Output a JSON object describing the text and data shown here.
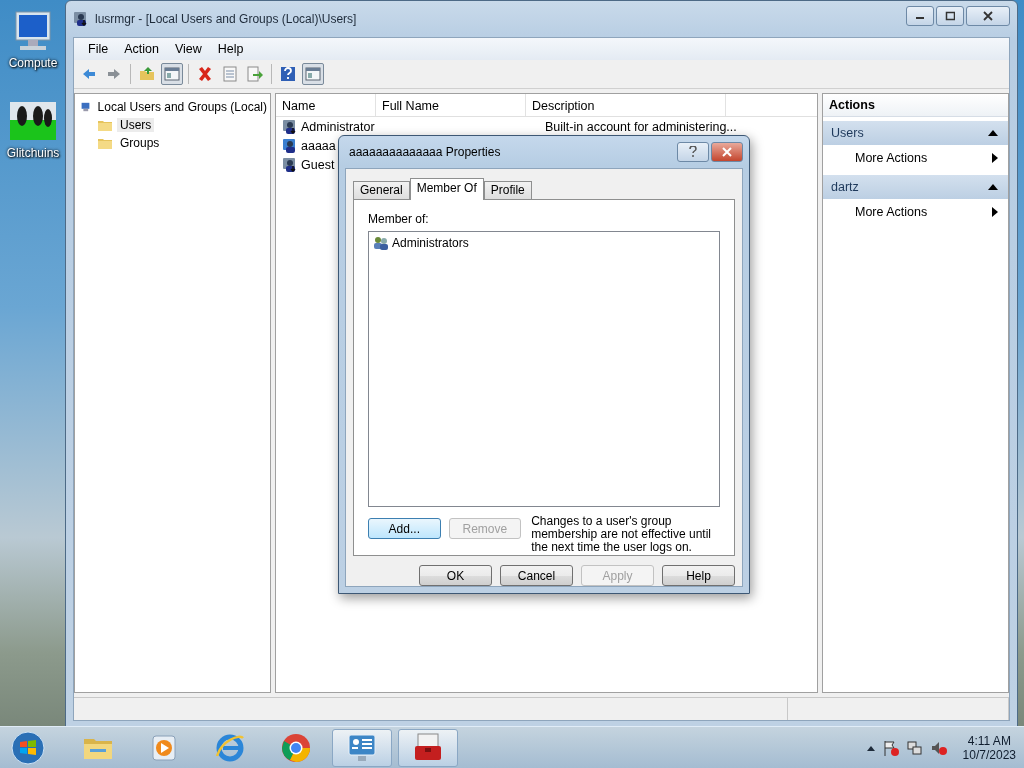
{
  "desktop_icons": [
    {
      "kind": "computer",
      "label": "Compute"
    },
    {
      "kind": "penguins",
      "label": "Glitchuins"
    }
  ],
  "window": {
    "title": "lusrmgr - [Local Users and Groups (Local)\\Users]"
  },
  "menu": [
    "File",
    "Action",
    "View",
    "Help"
  ],
  "toolbar": [
    {
      "kind": "back"
    },
    {
      "kind": "forward"
    },
    {
      "kind": "sep"
    },
    {
      "kind": "up"
    },
    {
      "kind": "pane",
      "selected": true
    },
    {
      "kind": "sep"
    },
    {
      "kind": "delete"
    },
    {
      "kind": "props"
    },
    {
      "kind": "export"
    },
    {
      "kind": "sep"
    },
    {
      "kind": "help"
    },
    {
      "kind": "pane",
      "selected": true
    }
  ],
  "tree": {
    "label": "Local Users and Groups (Local)",
    "children": [
      {
        "label": "Users",
        "selected": true
      },
      {
        "label": "Groups",
        "selected": false
      }
    ]
  },
  "list": {
    "columns": [
      "Name",
      "Full Name",
      "Description"
    ],
    "rows": [
      {
        "name": "Administrator",
        "full_name": "",
        "description": "Built-in account for administering...",
        "kind": "builtin"
      },
      {
        "name": "aaaaa",
        "description": "",
        "kind": "user"
      },
      {
        "name": "Guest",
        "description": "",
        "kind": "builtin"
      }
    ]
  },
  "actions": {
    "title": "Actions",
    "sections": [
      {
        "title": "Users",
        "expanded": true,
        "items": [
          "More Actions"
        ]
      },
      {
        "title": "dartz",
        "expanded": true,
        "items": [
          "More Actions"
        ]
      }
    ]
  },
  "dialog": {
    "title": "aaaaaaaaaaaaaa Properties",
    "tabs": [
      {
        "label": "General",
        "selected": false
      },
      {
        "label": "Member Of",
        "selected": true
      },
      {
        "label": "Profile",
        "selected": false
      }
    ],
    "member_label": "Member of:",
    "members": [
      "Administrators"
    ],
    "buttons": [
      {
        "label": "Add...",
        "disabled": false,
        "focused": true
      },
      {
        "label": "Remove",
        "disabled": true,
        "focused": false
      }
    ],
    "note": "Changes to a user's group membership are not effective until the next time the user logs on.",
    "footer_buttons": [
      {
        "label": "OK",
        "disabled": false
      },
      {
        "label": "Cancel",
        "disabled": false
      },
      {
        "label": "Apply",
        "disabled": true
      },
      {
        "label": "Help",
        "disabled": false
      }
    ]
  },
  "taskbar": {
    "items": [
      {
        "kind": "folder",
        "active": false
      },
      {
        "kind": "media",
        "active": false
      },
      {
        "kind": "ie",
        "active": false
      },
      {
        "kind": "chrome",
        "active": false
      },
      {
        "kind": "panel",
        "active": true
      },
      {
        "kind": "toolbox",
        "active": true
      }
    ],
    "time": "4:11 AM",
    "date": "10/7/2023"
  }
}
